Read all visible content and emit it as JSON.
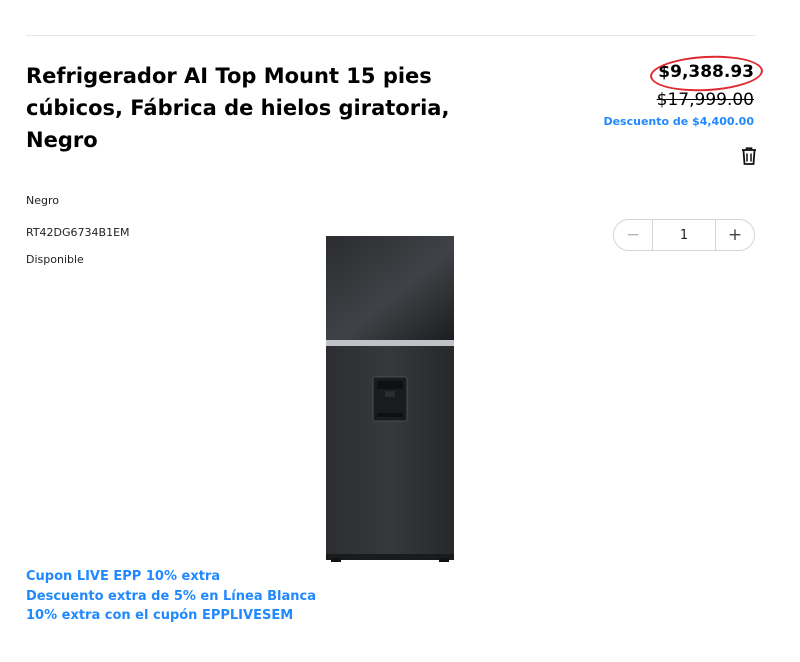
{
  "product": {
    "title": "Refrigerador AI Top Mount 15 pies cúbicos, Fábrica de hielos giratoria, Negro",
    "price": "$9,388.93",
    "old_price": "$17,999.00",
    "discount": "Descuento de $4,400.00",
    "color": "Negro",
    "model": "RT42DG6734B1EM",
    "availability": "Disponible",
    "image_icon": "refrigerator-image"
  },
  "quantity": {
    "minus": "−",
    "value": "1",
    "plus": "+"
  },
  "coupons": [
    "Cupon LIVE EPP 10% extra",
    "Descuento extra de 5% en Línea Blanca",
    "10% extra con el cupón EPPLIVESEM"
  ],
  "icons": {
    "delete": "trash-icon"
  },
  "colors": {
    "accent_blue": "#2189ff",
    "highlight_red": "#e0282f"
  }
}
